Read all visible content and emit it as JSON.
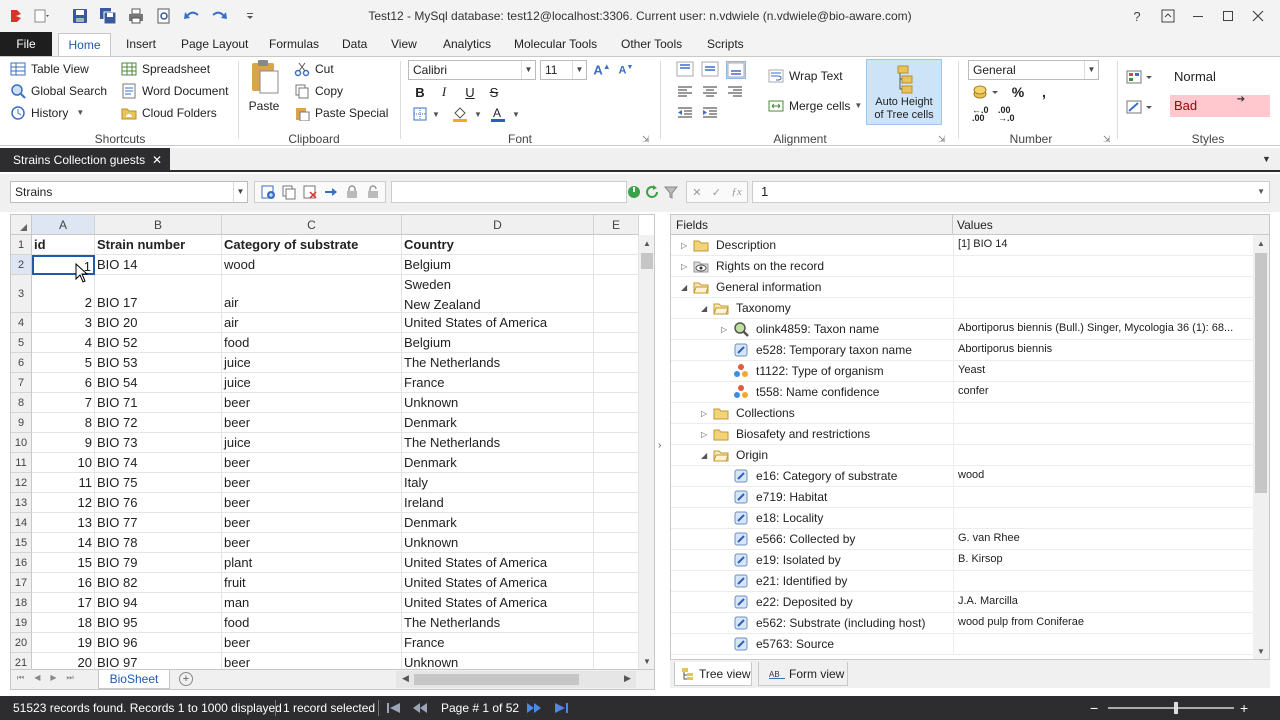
{
  "window": {
    "title": "Test12 - MySql database: test12@localhost:3306. Current user: n.vdwiele (n.vdwiele@bio-aware.com)"
  },
  "ribbon_tabs": [
    "File",
    "Home",
    "Insert",
    "Page Layout",
    "Formulas",
    "Data",
    "View",
    "Analytics",
    "Molecular Tools",
    "Other Tools",
    "Scripts"
  ],
  "shortcuts": {
    "table_view": "Table View",
    "global_search": "Global Search",
    "history": "History",
    "spreadsheet": "Spreadsheet",
    "word_document": "Word Document",
    "cloud_folders": "Cloud Folders",
    "group": "Shortcuts"
  },
  "clipboard": {
    "paste": "Paste",
    "cut": "Cut",
    "copy": "Copy",
    "paste_special": "Paste Special",
    "group": "Clipboard"
  },
  "font": {
    "family": "Calibri",
    "size": "11",
    "group": "Font"
  },
  "alignment": {
    "wrap_text": "Wrap Text",
    "merge_cells": "Merge cells",
    "auto_height_1": "Auto Height",
    "auto_height_2": "of Tree cells",
    "group": "Alignment"
  },
  "number": {
    "format": "General",
    "group": "Number"
  },
  "styles": {
    "normal": "Normal",
    "bad": "Bad",
    "group": "Styles"
  },
  "doc_tab": {
    "label": "Strains Collection guests"
  },
  "toolbar": {
    "table_select": "Strains",
    "formula_value": "1"
  },
  "sheet": {
    "columns": [
      "A",
      "B",
      "C",
      "D",
      "E"
    ],
    "header": {
      "num": "1",
      "a": "id",
      "b": "Strain number",
      "c": "Category of substrate",
      "d": "Country"
    },
    "rows": [
      {
        "num": "2",
        "a": "1",
        "b": "BIO 14",
        "c": "wood",
        "d": "Belgium"
      },
      {
        "num": "3",
        "a": "2",
        "b": "BIO 17",
        "c": "air",
        "d": "Sweden",
        "d2": "New Zealand"
      },
      {
        "num": "4",
        "a": "3",
        "b": "BIO 20",
        "c": "air",
        "d": "United States of America"
      },
      {
        "num": "5",
        "a": "4",
        "b": "BIO 52",
        "c": "food",
        "d": "Belgium"
      },
      {
        "num": "6",
        "a": "5",
        "b": "BIO 53",
        "c": "juice",
        "d": "The Netherlands"
      },
      {
        "num": "7",
        "a": "6",
        "b": "BIO 54",
        "c": "juice",
        "d": "France"
      },
      {
        "num": "8",
        "a": "7",
        "b": "BIO 71",
        "c": "beer",
        "d": "Unknown"
      },
      {
        "num": "9",
        "a": "8",
        "b": "BIO 72",
        "c": "beer",
        "d": "Denmark"
      },
      {
        "num": "10",
        "a": "9",
        "b": "BIO 73",
        "c": "juice",
        "d": "The Netherlands"
      },
      {
        "num": "11",
        "a": "10",
        "b": "BIO 74",
        "c": "beer",
        "d": "Denmark"
      },
      {
        "num": "12",
        "a": "11",
        "b": "BIO 75",
        "c": "beer",
        "d": "Italy"
      },
      {
        "num": "13",
        "a": "12",
        "b": "BIO 76",
        "c": "beer",
        "d": "Ireland"
      },
      {
        "num": "14",
        "a": "13",
        "b": "BIO 77",
        "c": "beer",
        "d": "Denmark"
      },
      {
        "num": "15",
        "a": "14",
        "b": "BIO 78",
        "c": "beer",
        "d": "Unknown"
      },
      {
        "num": "16",
        "a": "15",
        "b": "BIO 79",
        "c": "plant",
        "d": "United States of America"
      },
      {
        "num": "17",
        "a": "16",
        "b": "BIO 82",
        "c": "fruit",
        "d": "United States of America"
      },
      {
        "num": "18",
        "a": "17",
        "b": "BIO 94",
        "c": "man",
        "d": "United States of America"
      },
      {
        "num": "19",
        "a": "18",
        "b": "BIO 95",
        "c": "food",
        "d": "The Netherlands"
      },
      {
        "num": "20",
        "a": "19",
        "b": "BIO 96",
        "c": "beer",
        "d": "France"
      },
      {
        "num": "21",
        "a": "20",
        "b": "BIO 97",
        "c": "beer",
        "d": "Unknown"
      }
    ],
    "sheet_tab": "BioSheet"
  },
  "panel": {
    "fields_header": "Fields",
    "values_header": "Values",
    "rows": [
      {
        "label": "Description",
        "value": "[1] BIO 14",
        "level": 0,
        "exp": "right",
        "icon": "folder-icon"
      },
      {
        "label": "Rights on the record",
        "value": "",
        "level": 0,
        "exp": "right",
        "icon": "eye-icon"
      },
      {
        "label": "General information",
        "value": "",
        "level": 0,
        "exp": "down",
        "icon": "folder-open-icon"
      },
      {
        "label": "Taxonomy",
        "value": "",
        "level": 1,
        "exp": "down",
        "icon": "folder-open-icon"
      },
      {
        "label": "olink4859: Taxon name",
        "value": "Abortiporus biennis (Bull.) Singer, Mycologia 36 (1): 68...",
        "level": 2,
        "exp": "right",
        "icon": "magnifier-link-icon"
      },
      {
        "label": "e528: Temporary taxon name",
        "value": "Abortiporus biennis",
        "level": 2,
        "exp": "",
        "icon": "edit-field-icon"
      },
      {
        "label": "t1122: Type of organism",
        "value": "Yeast",
        "level": 2,
        "exp": "",
        "icon": "dots-icon"
      },
      {
        "label": "t558: Name confidence",
        "value": "confer",
        "level": 2,
        "exp": "",
        "icon": "dots-icon"
      },
      {
        "label": "Collections",
        "value": "",
        "level": 1,
        "exp": "right",
        "icon": "folder-icon"
      },
      {
        "label": "Biosafety and restrictions",
        "value": "",
        "level": 1,
        "exp": "right",
        "icon": "folder-icon"
      },
      {
        "label": "Origin",
        "value": "",
        "level": 1,
        "exp": "down",
        "icon": "folder-open-icon"
      },
      {
        "label": "e16: Category of substrate",
        "value": "wood",
        "level": 2,
        "exp": "",
        "icon": "edit-field-icon"
      },
      {
        "label": "e719: Habitat",
        "value": "",
        "level": 2,
        "exp": "",
        "icon": "edit-field-icon"
      },
      {
        "label": "e18: Locality",
        "value": "",
        "level": 2,
        "exp": "",
        "icon": "edit-field-icon"
      },
      {
        "label": "e566: Collected by",
        "value": "G. van Rhee",
        "level": 2,
        "exp": "",
        "icon": "edit-field-icon"
      },
      {
        "label": "e19: Isolated by",
        "value": "B. Kirsop",
        "level": 2,
        "exp": "",
        "icon": "edit-field-icon"
      },
      {
        "label": "e21: Identified by",
        "value": "",
        "level": 2,
        "exp": "",
        "icon": "edit-field-icon"
      },
      {
        "label": "e22: Deposited by",
        "value": "J.A. Marcilla",
        "level": 2,
        "exp": "",
        "icon": "edit-field-icon"
      },
      {
        "label": "e562: Substrate (including host)",
        "value": "wood pulp from Coniferae",
        "level": 2,
        "exp": "",
        "icon": "edit-field-icon"
      },
      {
        "label": "e5763: Source",
        "value": "",
        "level": 2,
        "exp": "",
        "icon": "edit-field-icon"
      }
    ],
    "tree_view": "Tree view",
    "form_view": "Form view"
  },
  "status": {
    "records": "51523 records found. Records 1 to 1000 displayed",
    "selected": "1 record selected",
    "page": "Page # 1 of 52"
  }
}
